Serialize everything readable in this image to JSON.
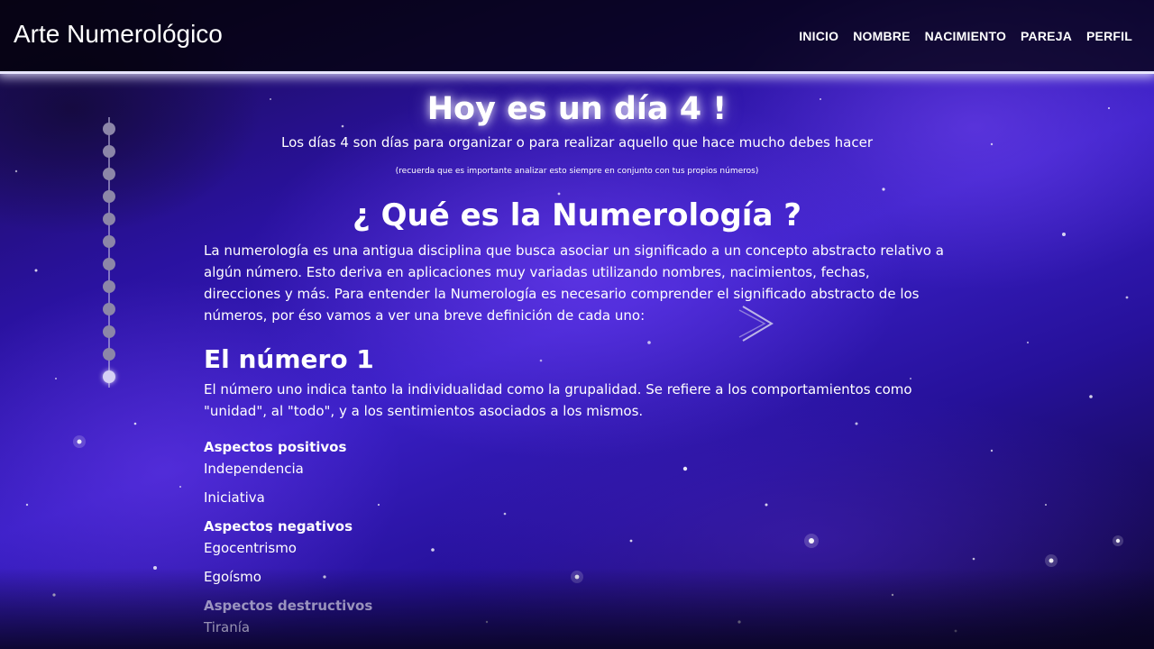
{
  "app": {
    "brand": "Arte Numerológico"
  },
  "nav": {
    "items": [
      {
        "label": "INICIO"
      },
      {
        "label": "NOMBRE"
      },
      {
        "label": "NACIMIENTO"
      },
      {
        "label": "PAREJA"
      },
      {
        "label": "PERFIL"
      }
    ]
  },
  "pagination": {
    "count": 12,
    "active_index": 11
  },
  "hero": {
    "title": "Hoy es un día 4 !",
    "subtitle": "Los días 4 son días para organizar o para realizar aquello que hace mucho debes hacer",
    "note": "(recuerda que es importante analizar esto siempre en conjunto con tus propios números)"
  },
  "section": {
    "title": "¿ Qué es la Numerología ?",
    "intro": "La numerología es una antigua disciplina que busca asociar un significado a un concepto abstracto relativo a algún número. Esto deriva en aplicaciones muy variadas utilizando nombres, nacimientos, fechas, direcciones y más. Para entender la Numerología es necesario comprender el significado abstracto de los números, por éso vamos a ver una breve definición de cada uno:"
  },
  "number": {
    "title": "El número 1",
    "description": "El número uno indica tanto la individualidad como la grupalidad. Se refiere a los comportamientos como \"unidad\", al \"todo\", y a los sentimientos asociados a los mismos.",
    "positive": {
      "heading": "Aspectos positivos",
      "items": [
        "Independencia",
        "Iniciativa"
      ]
    },
    "negative": {
      "heading": "Aspectos negativos",
      "items": [
        "Egocentrismo",
        "Egoísmo"
      ]
    },
    "destructive": {
      "heading": "Aspectos destructivos",
      "items": [
        "Tiranía"
      ]
    }
  },
  "carousel": {
    "next_icon": "chevron-right-icon"
  },
  "colors": {
    "nav_border_glow": "#e8e6ff",
    "background_accent": "#3a1fc6",
    "dot_inactive": "#8c86a8",
    "dot_active": "#d6d0f5"
  }
}
